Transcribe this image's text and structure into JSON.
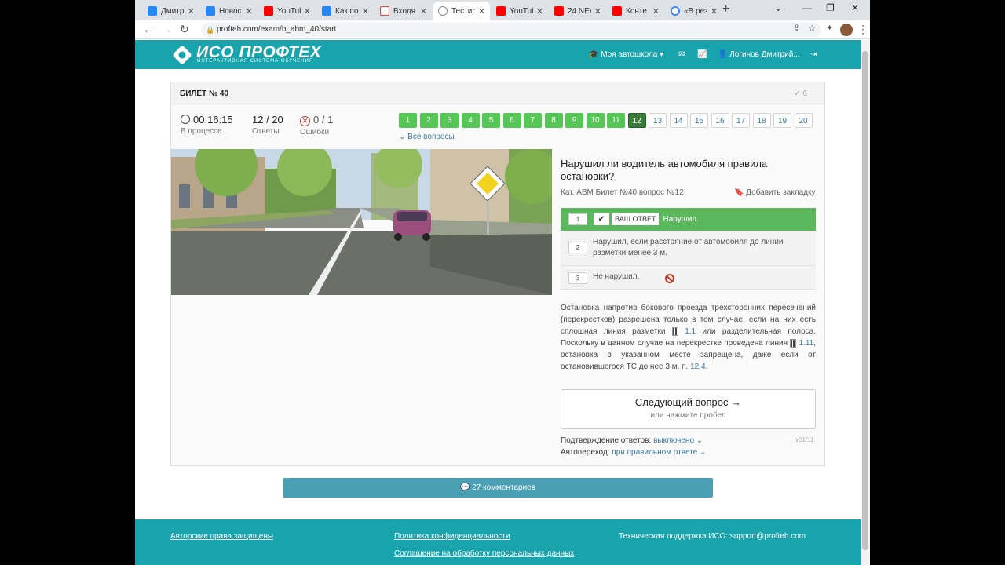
{
  "browser": {
    "tabs": [
      {
        "title": "Дмитр",
        "icon": "vk-icon",
        "active": false
      },
      {
        "title": "Новос",
        "icon": "vk-icon",
        "active": false
      },
      {
        "title": "YouTub",
        "icon": "youtube-icon",
        "active": false
      },
      {
        "title": "Как по",
        "icon": "vk-icon",
        "active": false
      },
      {
        "title": "Входя",
        "icon": "gmail-icon",
        "active": false
      },
      {
        "title": "Тестир",
        "icon": "school-icon",
        "active": true
      },
      {
        "title": "YouTub",
        "icon": "youtube-icon",
        "active": false
      },
      {
        "title": "24 NEW",
        "icon": "youtube-icon",
        "active": false
      },
      {
        "title": "Конте",
        "icon": "youtube-icon",
        "active": false
      },
      {
        "title": "«В рез",
        "icon": "google-icon",
        "active": false
      }
    ],
    "url": "profteh.com/exam/b_abm_40/start"
  },
  "header": {
    "logo_title": "ИСО ПРОФТЕХ",
    "logo_subtitle": "ИНТЕРАКТИВНАЯ СИСТЕМА ОБУЧЕНИЯ",
    "school": "Моя автошкола",
    "user": "Логинов Дмитрий..."
  },
  "ticket": {
    "title": "БИЛЕТ № 40",
    "check_count": "6",
    "timer": "00:16:15",
    "timer_label": "В процессе",
    "answers": "12 / 20",
    "answers_label": "Ответы",
    "errors": "0 / 1",
    "errors_label": "Ошибки",
    "all_questions": "Все вопросы",
    "question_numbers": [
      "1",
      "2",
      "3",
      "4",
      "5",
      "6",
      "7",
      "8",
      "9",
      "10",
      "11",
      "12",
      "13",
      "14",
      "15",
      "16",
      "17",
      "18",
      "19",
      "20"
    ],
    "answered_count": 11,
    "current": 12
  },
  "question": {
    "text": "Нарушил ли водитель автомобиля правила остановки?",
    "meta": "Кат. ABM   Билет №40   вопрос №12",
    "bookmark": "Добавить закладку",
    "your_answer_label": "ВАШ ОТВЕТ",
    "answers": [
      {
        "num": "1",
        "text": "Нарушил."
      },
      {
        "num": "2",
        "text": "Нарушил, если расстояние от автомобиля до линии разметки менее 3 м."
      },
      {
        "num": "3",
        "text": "Не нарушил."
      }
    ]
  },
  "explanation": {
    "p1": "Остановка напротив бокового проезда трехсторонних пересечений (перекрестков) разрешена только в том случае, если на них есть сплошная линия разметки",
    "link1": "1.1",
    "p2": "или разделительная полоса. Поскольку в данном случае на перекрестке проведена линия",
    "link2": "1.11",
    "p3": ", остановка в указанном месте запрещена, даже если от остановившегося ТС до нее 3 м. п.",
    "link3": "12.4",
    "p4": "."
  },
  "next": {
    "label": "Следующий вопрос →",
    "hint": "или нажмите пробел"
  },
  "options": {
    "confirm_label": "Подтверждение ответов:",
    "confirm_value": "выключено",
    "auto_label": "Автопереход:",
    "auto_value": "при правильном ответе",
    "version": "v01/11"
  },
  "comments": "27 комментариев",
  "footer": {
    "copyright": "Авторские права защищены",
    "privacy": "Политика конфиденциальности",
    "agreement": "Соглашение на обработку персональных данных",
    "support": "Техническая поддержка ИСО:  support@profteh.com"
  },
  "colors": {
    "brand": "#19a3ad",
    "answered": "#56c656",
    "current": "#3a7a3a"
  }
}
